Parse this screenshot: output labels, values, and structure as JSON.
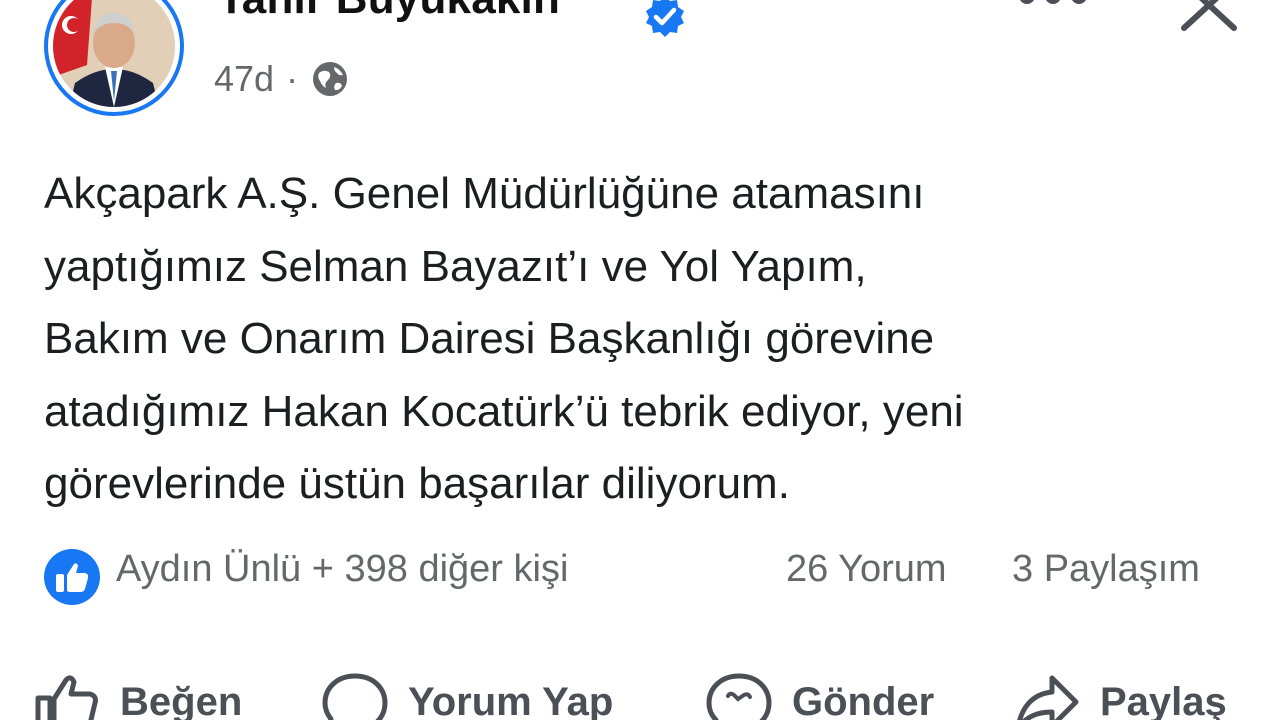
{
  "post": {
    "author": "Tahir Büyükakın",
    "time": "47d",
    "text_lines": [
      "Akçapark A.Ş. Genel Müdürlüğüne atamasını",
      "yaptığımız Selman Bayazıt’ı ve Yol Yapım,",
      "Bakım ve Onarım Dairesi Başkanlığı görevine",
      "atadığımız Hakan Kocatürk’ü tebrik ediyor, yeni",
      "görevlerinde üstün başarılar diliyorum."
    ]
  },
  "stats": {
    "reactors": "Aydın Ünlü + 398 diğer kişi",
    "comments": "26 Yorum",
    "shares": "3 Paylaşım"
  },
  "actions": {
    "like": "Beğen",
    "comment": "Yorum Yap",
    "send": "Gönder",
    "share": "Paylaş"
  },
  "icons": {
    "verified": "verified-badge-icon",
    "privacy": "globe-icon",
    "more": "more-options-icon",
    "close": "close-icon",
    "reaction": "thumbs-up-icon",
    "like": "thumbs-up-outline-icon",
    "comment": "speech-bubble-icon",
    "send": "messenger-icon",
    "share": "share-arrow-icon"
  },
  "colors": {
    "accent": "#1877f2",
    "secondary_text": "#65676b",
    "text": "#1c1e21"
  }
}
